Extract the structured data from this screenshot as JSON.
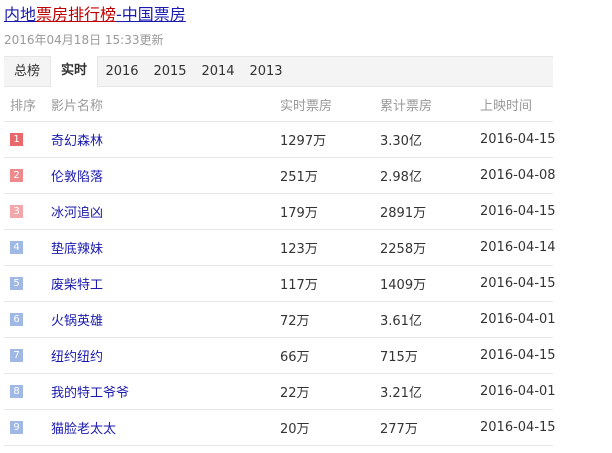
{
  "header": {
    "title_part1": "内地",
    "title_part2": "票房排行榜",
    "title_part3": "-中国票房",
    "updated": "2016年04月18日 15:33更新"
  },
  "tabs": [
    {
      "label": "总榜",
      "active": false
    },
    {
      "label": "实时",
      "active": true
    },
    {
      "label": "2016",
      "active": false
    },
    {
      "label": "2015",
      "active": false
    },
    {
      "label": "2014",
      "active": false
    },
    {
      "label": "2013",
      "active": false
    }
  ],
  "table": {
    "headers": [
      "排序",
      "影片名称",
      "实时票房",
      "累计票房",
      "上映时间"
    ],
    "rows": [
      {
        "rank": "1",
        "badge_color": "#e8686c",
        "name": "奇幻森林",
        "realtime": "1297万",
        "total": "3.30亿",
        "date": "2016-04-15"
      },
      {
        "rank": "2",
        "badge_color": "#ee8a8c",
        "name": "伦敦陷落",
        "realtime": "251万",
        "total": "2.98亿",
        "date": "2016-04-08"
      },
      {
        "rank": "3",
        "badge_color": "#f2a8aa",
        "name": "冰河追凶",
        "realtime": "179万",
        "total": "2891万",
        "date": "2016-04-15"
      },
      {
        "rank": "4",
        "badge_color": "#9fb8e4",
        "name": "垫底辣妹",
        "realtime": "123万",
        "total": "2258万",
        "date": "2016-04-14"
      },
      {
        "rank": "5",
        "badge_color": "#9fb8e4",
        "name": "废柴特工",
        "realtime": "117万",
        "total": "1409万",
        "date": "2016-04-15"
      },
      {
        "rank": "6",
        "badge_color": "#9fb8e4",
        "name": "火锅英雄",
        "realtime": "72万",
        "total": "3.61亿",
        "date": "2016-04-01"
      },
      {
        "rank": "7",
        "badge_color": "#9fb8e4",
        "name": "纽约纽约",
        "realtime": "66万",
        "total": "715万",
        "date": "2016-04-15"
      },
      {
        "rank": "8",
        "badge_color": "#9fb8e4",
        "name": "我的特工爷爷",
        "realtime": "22万",
        "total": "3.21亿",
        "date": "2016-04-01"
      },
      {
        "rank": "9",
        "badge_color": "#9fb8e4",
        "name": "猫脸老太太",
        "realtime": "20万",
        "total": "277万",
        "date": "2016-04-15"
      }
    ]
  }
}
